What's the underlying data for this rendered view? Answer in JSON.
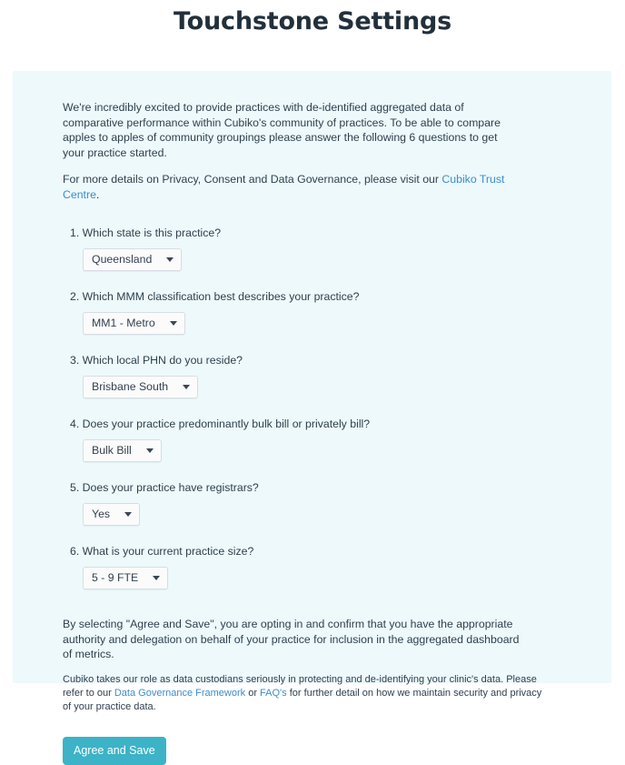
{
  "header": {
    "title": "Touchstone Settings"
  },
  "intro": {
    "paragraph1": "We're incredibly excited to provide practices with de-identified aggregated data of comparative performance within Cubiko's community of practices. To be able to compare apples to apples of community groupings please answer the following 6 questions to get your practice started.",
    "paragraph2_prefix": "For more details on Privacy, Consent and Data Governance, please visit our ",
    "trust_centre_link": "Cubiko Trust Centre",
    "paragraph2_suffix": "."
  },
  "questions": [
    {
      "label": "1. Which state is this practice?",
      "value": "Queensland",
      "name": "state"
    },
    {
      "label": "2. Which MMM classification best describes your practice?",
      "value": "MM1 - Metro",
      "name": "mmm-classification"
    },
    {
      "label": "3. Which local PHN do you reside?",
      "value": "Brisbane South",
      "name": "phn"
    },
    {
      "label": "4. Does your practice predominantly bulk bill or privately bill?",
      "value": "Bulk Bill",
      "name": "billing-type"
    },
    {
      "label": "5. Does your practice have registrars?",
      "value": "Yes",
      "name": "registrars"
    },
    {
      "label": "6. What is your current practice size?",
      "value": "5 - 9 FTE",
      "name": "practice-size"
    }
  ],
  "consent": {
    "paragraph": "By selecting \"Agree and Save\", you are opting in and confirm that you have the appropriate authority and delegation on behalf of your practice for inclusion in the aggregated dashboard of metrics.",
    "fineprint_part1": "Cubiko takes our role as data custodians seriously in protecting and de-identifying your clinic's data. Please refer to our ",
    "governance_link": "Data Governance Framework",
    "fineprint_part2": " or ",
    "faq_link": "FAQ's",
    "fineprint_part3": " for further detail on how we maintain security and privacy of your practice data."
  },
  "actions": {
    "agree_and_save": "Agree and Save"
  },
  "colors": {
    "card_background": "#edf9fb",
    "page_background": "#ffffff",
    "link": "#3c8dcb",
    "button": "#3cb3c6",
    "title": "#22303c",
    "text": "#2f3f4d"
  },
  "icons": {
    "caret": "chevron-down-icon"
  }
}
